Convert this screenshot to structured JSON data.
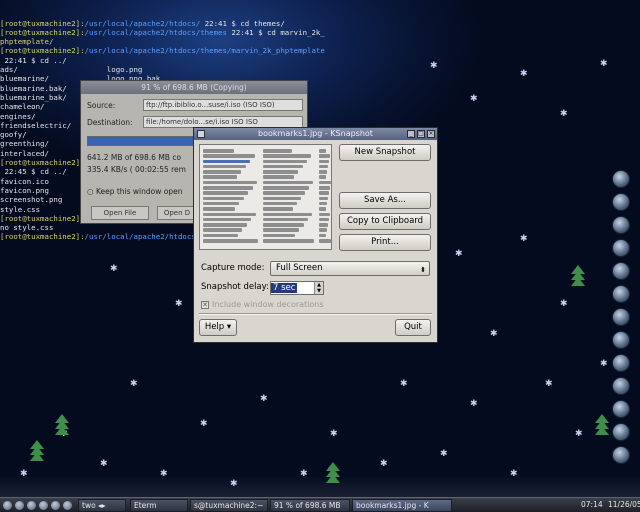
{
  "terminal": {
    "lines": [
      {
        "prompt": "[root@tuxmachine2]:",
        "path": "/usr/local/apache2/htdocs/",
        "rest": " 22:41 $ cd themes/"
      },
      {
        "prompt": "[root@tuxmachine2]:",
        "path": "/usr/local/apache2/htdocs/themes",
        "rest": " 22:41 $ cd marvin_2k_"
      },
      {
        "prompt": "phptemplate/",
        "path": "",
        "rest": ""
      },
      {
        "prompt": "[root@tuxmachine2]:",
        "path": "/usr/local/apache2/htdocs/themes/marvin_2k_phptemplate",
        "rest": ""
      },
      {
        "prompt": "",
        "path": "",
        "rest": " 22:41 $ cd ../"
      },
      {
        "prompt": "",
        "path": "",
        "rest": "ads/                    logo.png"
      },
      {
        "prompt": "",
        "path": "",
        "rest": "bluemarine/             logo.png.bak"
      },
      {
        "prompt": "",
        "path": "",
        "rest": "bluemarine.bak/         marvin_2k_phptemplate/"
      },
      {
        "prompt": "",
        "path": "",
        "rest": "bluemarine_bak/"
      },
      {
        "prompt": "",
        "path": "",
        "rest": "chameleon/"
      },
      {
        "prompt": "",
        "path": "",
        "rest": "engines/"
      },
      {
        "prompt": "",
        "path": "",
        "rest": "friendselectric/"
      },
      {
        "prompt": "",
        "path": "",
        "rest": "goofy/"
      },
      {
        "prompt": "",
        "path": "",
        "rest": "greenthing/"
      },
      {
        "prompt": "",
        "path": "",
        "rest": "interlaced/"
      },
      {
        "prompt": "[root@tuxmachine2]:",
        "path": "",
        "rest": ""
      },
      {
        "prompt": "",
        "path": "",
        "rest": " 22:45 $ cd ../"
      },
      {
        "prompt": "",
        "path": "",
        "rest": "favicon.ico"
      },
      {
        "prompt": "",
        "path": "",
        "rest": "favicon.png"
      },
      {
        "prompt": "",
        "path": "",
        "rest": "screenshot.png"
      },
      {
        "prompt": "",
        "path": "",
        "rest": "style.css"
      },
      {
        "prompt": "[root@tuxmachine2]:",
        "path": "",
        "rest": ""
      },
      {
        "prompt": "",
        "path": "",
        "rest": "no style.css"
      },
      {
        "prompt": "[root@tuxmachine2]:",
        "path": "/usr/local/apache2/htdocs/",
        "rest": ""
      }
    ]
  },
  "transfer_dialog": {
    "title": "91 % of 698.6 MB (Copying)",
    "source_label": "Source:",
    "source_value": "ftp://ftp.ibiblio.o...suse/i.iso (ISO ISO)",
    "destination_label": "Destination:",
    "destination_value": "file:/home/dolo...se/i.iso ISO ISO",
    "progress_fraction": 0.91,
    "size_text": "641.2 MB of 698.6 MB co",
    "rate_text": "335.4 KB/s ( 00:02:55 rem",
    "keep_open_label": "Keep this window open",
    "open_file_label": "Open File",
    "open_dest_label": "Open D"
  },
  "ksnapshot": {
    "title": "bookmarks1.jpg - KSnapshot",
    "new_snapshot_label": "New Snapshot",
    "save_as_label": "Save As...",
    "copy_clipboard_label": "Copy to Clipboard",
    "print_label": "Print...",
    "capture_mode_label": "Capture mode:",
    "capture_mode_value": "Full Screen",
    "snapshot_delay_label": "Snapshot delay:",
    "snapshot_delay_value": "7 sec",
    "include_decorations_label": "Include window decorations",
    "include_decorations_checked": true,
    "help_label": "Help",
    "quit_label": "Quit"
  },
  "taskbar": {
    "desktop_label": "two",
    "tasks": [
      {
        "label": "Eterm",
        "active": false
      },
      {
        "label": "s@tuxmachine2:~",
        "active": false
      },
      {
        "label": "91 % of 698.6 MB",
        "active": false
      },
      {
        "label": "bookmarks1.jpg - K",
        "active": true
      }
    ],
    "clock": "07:14",
    "date": "11/26/05"
  },
  "dock_icons": [
    "terminal-icon",
    "konqueror-icon",
    "mail-icon",
    "network-icon",
    "globe-icon",
    "home-icon",
    "settings-icon",
    "media-icon",
    "search-icon",
    "office-icon",
    "image-icon",
    "folder-icon",
    "trash-icon"
  ],
  "colors": {
    "accent": "#243b7a",
    "prompt": "#d8d86a",
    "path": "#5aa0ff",
    "window_bg": "#d8d6cf"
  }
}
